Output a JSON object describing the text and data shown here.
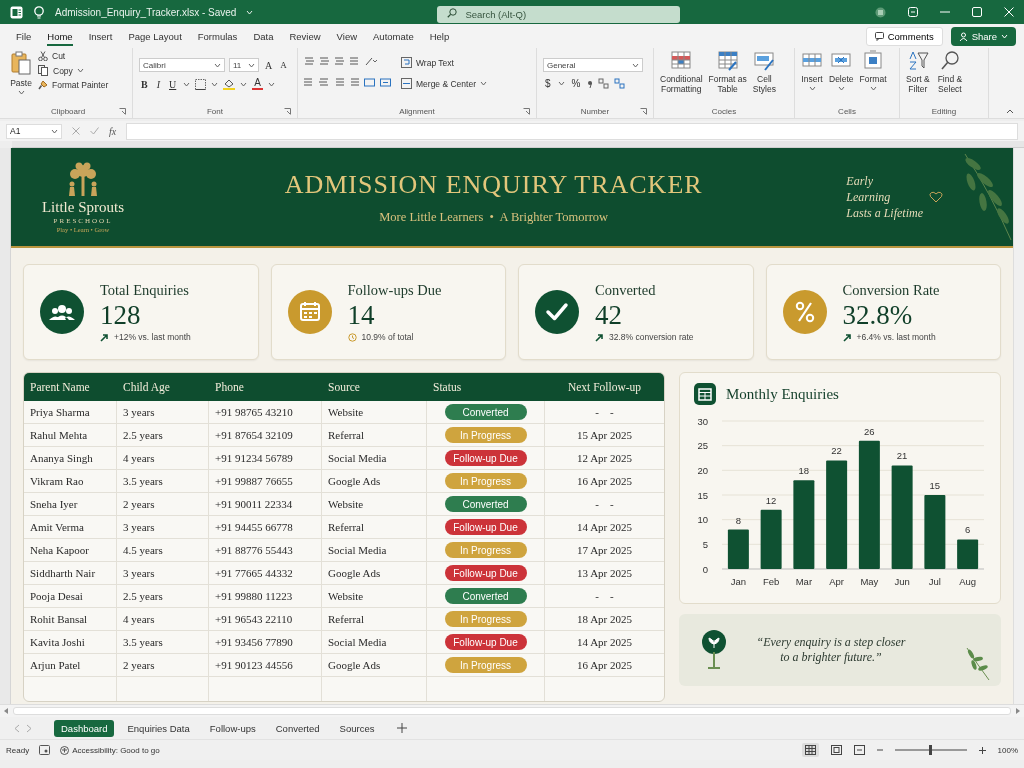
{
  "title_bar": {
    "document_title": "Admission_Enquiry_Tracker.xlsx - Saved",
    "search": {
      "placeholder": "Search (Alt-Q)"
    }
  },
  "menu_tabs": [
    {
      "label": "File",
      "selected": false
    },
    {
      "label": "Home",
      "selected": true
    },
    {
      "label": "Insert",
      "selected": false
    },
    {
      "label": "Page Layout",
      "selected": false
    },
    {
      "label": "Formulas",
      "selected": false
    },
    {
      "label": "Data",
      "selected": false
    },
    {
      "label": "Review",
      "selected": false
    },
    {
      "label": "View",
      "selected": false
    },
    {
      "label": "Automate",
      "selected": false
    },
    {
      "label": "Help",
      "selected": false
    }
  ],
  "comments_button": "Comments",
  "share_button": "Share",
  "ribbon": {
    "clipboard": {
      "label": "Clipboard",
      "paste": "Paste",
      "cut": "Cut",
      "copy": "Copy",
      "format_painter": "Format Painter"
    },
    "font": {
      "label": "Font",
      "family": "Calibri",
      "size": "11",
      "size_buttons": [
        "A",
        "A"
      ],
      "style_buttons": [
        "B",
        "I",
        "U"
      ],
      "font_color": "A"
    },
    "alignment": {
      "label": "Alignment",
      "wrap_text": "Wrap Text",
      "merge": "Merge & Center"
    },
    "number": {
      "label": "Number",
      "format": "General",
      "symbols": [
        "$",
        "%"
      ]
    },
    "styles": {
      "label": "Cocies",
      "buttons": [
        "Conditional\nFormatting",
        "Format as\nTable",
        "Cell\nStyles"
      ]
    },
    "cells": {
      "label": "Cells",
      "buttons": [
        "Insert",
        "Delete",
        "Format"
      ]
    },
    "editing": {
      "label": "Editing",
      "buttons": [
        "Sort &\nFilter",
        "Find &\nSelect"
      ]
    }
  },
  "formula_bar": {
    "name_box": "A1",
    "function_label": "fx"
  },
  "banner": {
    "logo_name": "Little Sprouts",
    "logo_sub": "PRESCHOOL",
    "logo_tagline": "Play • Learn • Grow",
    "title": "ADMISSION ENQUIRY TRACKER",
    "subtitle": "More Little Learners  •  A Brighter Tomorrow",
    "motto": "Early\nLearning\nLasts a Lifetime"
  },
  "kpis": [
    {
      "kind": "people",
      "color": "#0f5132",
      "title": "Total Enquiries",
      "value": "128",
      "note": {
        "text": "+12% vs. last month",
        "kind": "up"
      }
    },
    {
      "kind": "calendar",
      "color": "#c99a2e",
      "title": "Follow-ups Due",
      "value": "14",
      "note": {
        "text": "10.9% of total",
        "kind": "clock"
      }
    },
    {
      "kind": "check",
      "color": "#0f5132",
      "title": "Converted",
      "value": "42",
      "note": {
        "text": "32.8% conversion rate",
        "kind": "up"
      }
    },
    {
      "kind": "percent",
      "color": "#c99a2e",
      "title": "Conversion Rate",
      "value": "32.8%",
      "note": {
        "text": "+6.4% vs. last month",
        "kind": "up"
      }
    }
  ],
  "table": {
    "columns": [
      "Parent Name",
      "Child Age",
      "Phone",
      "Source",
      "Status",
      "Next Follow-up"
    ],
    "rows": [
      {
        "parent": "Priya Sharma",
        "age": "3 years",
        "phone": "+91 98765 43210",
        "source": "Website",
        "status": {
          "label": "Converted",
          "kind": "converted"
        },
        "next": "-    -"
      },
      {
        "parent": "Rahul Mehta",
        "age": "2.5 years",
        "phone": "+91 87654 32109",
        "source": "Referral",
        "status": {
          "label": "In Progress",
          "kind": "progress"
        },
        "next": "15 Apr 2025"
      },
      {
        "parent": "Ananya Singh",
        "age": "4 years",
        "phone": "+91 91234 56789",
        "source": "Social Media",
        "status": {
          "label": "Follow-up Due",
          "kind": "due"
        },
        "next": "12 Apr 2025"
      },
      {
        "parent": "Vikram Rao",
        "age": "3.5 years",
        "phone": "+91 99887 76655",
        "source": "Google Ads",
        "status": {
          "label": "In Progress",
          "kind": "progress"
        },
        "next": "16 Apr 2025"
      },
      {
        "parent": "Sneha Iyer",
        "age": "2 years",
        "phone": "+91 90011 22334",
        "source": "Website",
        "status": {
          "label": "Converted",
          "kind": "converted"
        },
        "next": "-    -"
      },
      {
        "parent": "Amit Verma",
        "age": "3 years",
        "phone": "+91 94455 66778",
        "source": "Referral",
        "status": {
          "label": "Follow-up Due",
          "kind": "due"
        },
        "next": "14 Apr 2025"
      },
      {
        "parent": "Neha Kapoor",
        "age": "4.5 years",
        "phone": "+91 88776 55443",
        "source": "Social Media",
        "status": {
          "label": "In Progress",
          "kind": "progress"
        },
        "next": "17 Apr 2025"
      },
      {
        "parent": "Siddharth Nair",
        "age": "3 years",
        "phone": "+91 77665 44332",
        "source": "Google Ads",
        "status": {
          "label": "Follow-up Due",
          "kind": "due"
        },
        "next": "13 Apr 2025"
      },
      {
        "parent": "Pooja Desai",
        "age": "2.5 years",
        "phone": "+91 99880 11223",
        "source": "Website",
        "status": {
          "label": "Converted",
          "kind": "converted"
        },
        "next": "-    -"
      },
      {
        "parent": "Rohit Bansal",
        "age": "4 years",
        "phone": "+91 96543 22110",
        "source": "Referral",
        "status": {
          "label": "In Progress",
          "kind": "progress"
        },
        "next": "18 Apr 2025"
      },
      {
        "parent": "Kavita Joshi",
        "age": "3.5 years",
        "phone": "+91 93456 77890",
        "source": "Social Media",
        "status": {
          "label": "Follow-up Due",
          "kind": "due"
        },
        "next": "14 Apr 2025"
      },
      {
        "parent": "Arjun Patel",
        "age": "2 years",
        "phone": "+91 90123 44556",
        "source": "Google Ads",
        "status": {
          "label": "In Progress",
          "kind": "progress"
        },
        "next": "16 Apr 2025"
      }
    ]
  },
  "chart_panel": {
    "title": "Monthly Enquiries",
    "chart_data": {
      "type": "bar",
      "categories": [
        "Jan",
        "Feb",
        "Mar",
        "Apr",
        "May",
        "Jun",
        "Jul",
        "Aug"
      ],
      "series": [
        {
          "color": "#0f5132",
          "values": [
            8,
            12,
            18,
            22,
            26,
            21,
            15,
            6
          ]
        }
      ],
      "ylim": [
        0,
        30
      ],
      "yticks": [
        0,
        5,
        10,
        15,
        20,
        25,
        30
      ],
      "data_labels": true,
      "grid": true
    }
  },
  "quote": "“Every enquiry is a step closer to a brighter future.”",
  "sheet_tabs": [
    {
      "label": "Dashboard",
      "selected": true
    },
    {
      "label": "Enquiries Data",
      "selected": false
    },
    {
      "label": "Follow-ups",
      "selected": false
    },
    {
      "label": "Converted",
      "selected": false
    },
    {
      "label": "Sources",
      "selected": false
    }
  ],
  "status_bar": {
    "ready": "Ready",
    "accessibility": "Accessibility: Good to go",
    "zoom": "100%",
    "zoom_slider": {
      "level": 0.5
    }
  }
}
